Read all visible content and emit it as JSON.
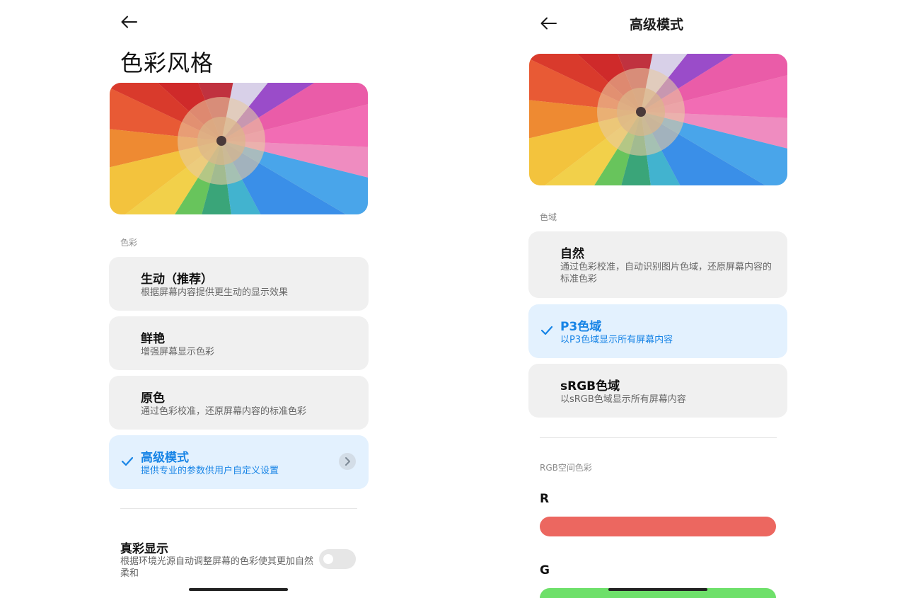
{
  "left_screen": {
    "title": "色彩风格",
    "back_icon": "arrow-left-icon",
    "section_label": "色彩",
    "options": [
      {
        "title": "生动（推荐）",
        "subtitle": "根据屏幕内容提供更生动的显示效果",
        "selected": false
      },
      {
        "title": "鲜艳",
        "subtitle": "增强屏幕显示色彩",
        "selected": false
      },
      {
        "title": "原色",
        "subtitle": "通过色彩校准，还原屏幕内容的标准色彩",
        "selected": false
      },
      {
        "title": "高级模式",
        "subtitle": "提供专业的参数供用户自定义设置",
        "selected": true,
        "has_chevron": true
      }
    ],
    "true_color": {
      "title": "真彩显示",
      "subtitle": "根据环境光源自动调整屏幕的色彩使其更加自然柔和",
      "enabled": false
    }
  },
  "right_screen": {
    "title": "高级模式",
    "back_icon": "arrow-left-icon",
    "gamut_section_label": "色域",
    "gamut_options": [
      {
        "title": "自然",
        "subtitle": "通过色彩校准，自动识别图片色域，还原屏幕内容的标准色彩",
        "selected": false
      },
      {
        "title": "P3色域",
        "subtitle": "以P3色域显示所有屏幕内容",
        "selected": true
      },
      {
        "title": "sRGB色域",
        "subtitle": "以sRGB色域显示所有屏幕内容",
        "selected": false
      }
    ],
    "rgb_section_label": "RGB空间色彩",
    "r_label": "R",
    "g_label": "G"
  },
  "colors": {
    "accent": "#1784e6",
    "selected_card_bg": "#e3f1fe",
    "card_bg": "#f0f0f0",
    "r_slider": "#ec6760",
    "g_slider": "#6ee06a"
  }
}
